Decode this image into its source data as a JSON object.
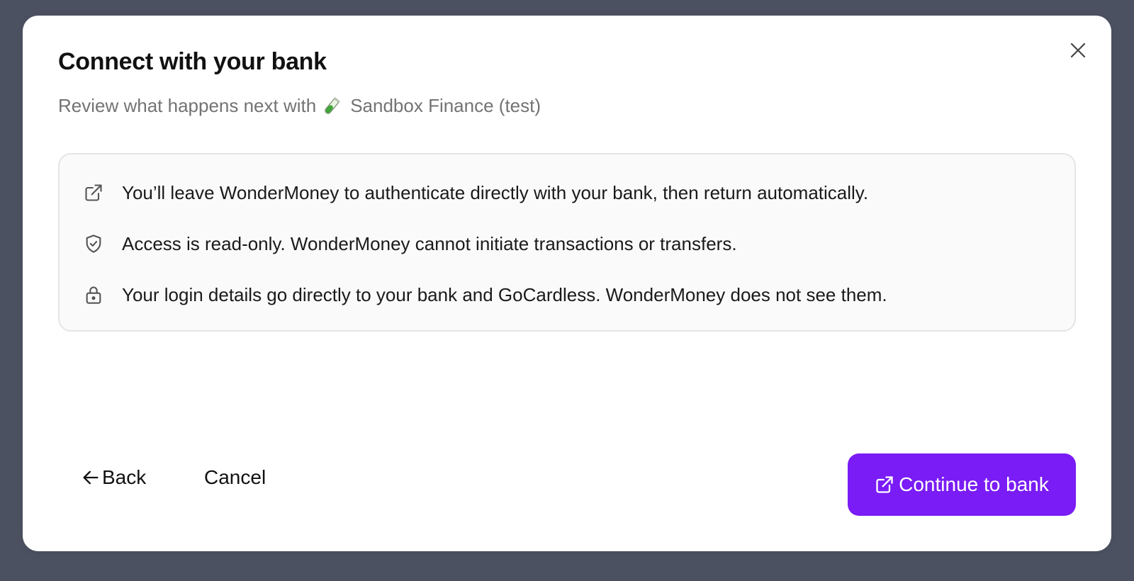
{
  "dialog": {
    "title": "Connect with your bank",
    "subtitle_prefix": "Review what happens next with",
    "bank_name": "Sandbox Finance (test)",
    "bank_icon": "test-tube-icon",
    "close_icon": "close-icon"
  },
  "info": {
    "items": [
      {
        "icon": "external-link-icon",
        "text": "You’ll leave WonderMoney to authenticate directly with your bank, then return automatically."
      },
      {
        "icon": "shield-check-icon",
        "text": "Access is read-only. WonderMoney cannot initiate transactions or transfers."
      },
      {
        "icon": "lock-icon",
        "text": "Your login details go directly to your bank and GoCardless. WonderMoney does not see them."
      }
    ]
  },
  "footer": {
    "back_label": "Back",
    "cancel_label": "Cancel",
    "continue_label": "Continue to bank"
  },
  "colors": {
    "backdrop": "#4c5161",
    "primary": "#7a1cf5",
    "info_bg": "#fafafa",
    "muted_text": "#737373"
  }
}
